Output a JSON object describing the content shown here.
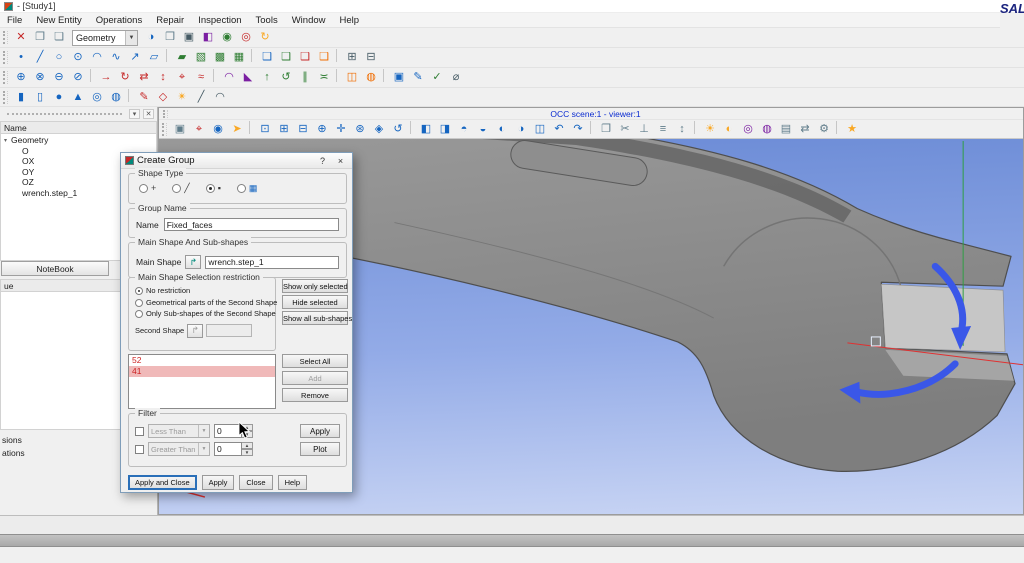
{
  "window": {
    "title": "- [Study1]",
    "logo": "SALOME"
  },
  "menubar": [
    "File",
    "New Entity",
    "Operations",
    "Repair",
    "Inspection",
    "Tools",
    "Window",
    "Help"
  ],
  "toolbar1": {
    "combo_value": "Geometry",
    "left_icons": [
      {
        "name": "delete-icon",
        "glyph": "✕",
        "color": "#c62828"
      },
      {
        "name": "copy-icon",
        "glyph": "❐",
        "color": "#5f7c8a"
      },
      {
        "name": "paste-icon",
        "glyph": "❏",
        "color": "#5f7c8a"
      }
    ],
    "right_icons": [
      {
        "name": "geometry-module-icon",
        "glyph": "◑",
        "color": "#1565c0"
      },
      {
        "name": "new-window-icon",
        "glyph": "❒",
        "color": "#5f7c8a"
      },
      {
        "name": "dump-view-icon",
        "glyph": "▣",
        "color": "#455a64"
      },
      {
        "name": "display-mode-icon",
        "glyph": "◧",
        "color": "#7b1fa2"
      },
      {
        "name": "show-all-icon",
        "glyph": "◉",
        "color": "#2e7d32"
      },
      {
        "name": "erase-all-icon",
        "glyph": "◎",
        "color": "#c62828"
      },
      {
        "name": "update-icon",
        "glyph": "↻",
        "color": "#f9a825"
      }
    ]
  },
  "toolbar2": {
    "icons": [
      {
        "name": "point-icon",
        "glyph": "•",
        "color": "#1565c0"
      },
      {
        "name": "line-icon",
        "glyph": "╱",
        "color": "#1565c0"
      },
      {
        "name": "circle-icon",
        "glyph": "○",
        "color": "#1565c0"
      },
      {
        "name": "ellipse-icon",
        "glyph": "⊙",
        "color": "#1565c0"
      },
      {
        "name": "arc-icon",
        "glyph": "◠",
        "color": "#1565c0"
      },
      {
        "name": "curve-icon",
        "glyph": "∿",
        "color": "#1565c0"
      },
      {
        "name": "vector-icon",
        "glyph": "↗",
        "color": "#1565c0"
      },
      {
        "name": "plane-icon",
        "glyph": "▱",
        "color": "#1565c0"
      },
      {
        "name": "separator",
        "sep": true,
        "interactable": "false"
      },
      {
        "name": "face-icon",
        "glyph": "▰",
        "color": "#2e7d32"
      },
      {
        "name": "shell-icon",
        "glyph": "▧",
        "color": "#2e7d32"
      },
      {
        "name": "solid-icon",
        "glyph": "▩",
        "color": "#2e7d32"
      },
      {
        "name": "compound-icon",
        "glyph": "▦",
        "color": "#2e7d32"
      },
      {
        "name": "separator",
        "sep": true,
        "interactable": "false"
      },
      {
        "name": "doc-blue-icon",
        "glyph": "❑",
        "color": "#1565c0"
      },
      {
        "name": "doc-green-icon",
        "glyph": "❑",
        "color": "#2e7d32"
      },
      {
        "name": "doc-red-icon",
        "glyph": "❑",
        "color": "#c62828"
      },
      {
        "name": "doc-yellow-icon",
        "glyph": "❑",
        "color": "#ef6c00"
      },
      {
        "name": "separator",
        "sep": true,
        "interactable": "false"
      },
      {
        "name": "grid-icon",
        "glyph": "⊞",
        "color": "#455a64"
      },
      {
        "name": "table-icon",
        "glyph": "⊟",
        "color": "#455a64"
      }
    ]
  },
  "toolbar3": {
    "icons": [
      {
        "name": "fuse-icon",
        "glyph": "⊕",
        "color": "#1565c0"
      },
      {
        "name": "common-icon",
        "glyph": "⊗",
        "color": "#1565c0"
      },
      {
        "name": "cut-icon",
        "glyph": "⊖",
        "color": "#1565c0"
      },
      {
        "name": "section-icon",
        "glyph": "⊘",
        "color": "#1565c0"
      },
      {
        "name": "separator",
        "sep": true,
        "interactable": "false"
      },
      {
        "name": "translate-icon",
        "glyph": "→",
        "color": "#c62828"
      },
      {
        "name": "rotate-icon",
        "glyph": "↻",
        "color": "#c62828"
      },
      {
        "name": "mirror-icon",
        "glyph": "⇄",
        "color": "#c62828"
      },
      {
        "name": "scale-icon",
        "glyph": "↕",
        "color": "#c62828"
      },
      {
        "name": "position-icon",
        "glyph": "⌖",
        "color": "#c62828"
      },
      {
        "name": "offset-icon",
        "glyph": "≈",
        "color": "#c62828"
      },
      {
        "name": "separator",
        "sep": true,
        "interactable": "false"
      },
      {
        "name": "fillet-icon",
        "glyph": "◠",
        "color": "#7b1fa2"
      },
      {
        "name": "chamfer-icon",
        "glyph": "◣",
        "color": "#7b1fa2"
      },
      {
        "name": "extrude-icon",
        "glyph": "↑",
        "color": "#2e7d32"
      },
      {
        "name": "revolve-icon",
        "glyph": "↺",
        "color": "#2e7d32"
      },
      {
        "name": "pipe-icon",
        "glyph": "∥",
        "color": "#2e7d32"
      },
      {
        "name": "loft-icon",
        "glyph": "≍",
        "color": "#2e7d32"
      },
      {
        "name": "separator",
        "sep": true,
        "interactable": "false"
      },
      {
        "name": "partition-icon",
        "glyph": "◫",
        "color": "#ef6c00"
      },
      {
        "name": "archimede-icon",
        "glyph": "◍",
        "color": "#ef6c00"
      },
      {
        "name": "separator",
        "sep": true,
        "interactable": "false"
      },
      {
        "name": "create-group-icon",
        "glyph": "▣",
        "color": "#1565c0"
      },
      {
        "name": "edit-group-icon",
        "glyph": "✎",
        "color": "#1565c0"
      },
      {
        "name": "check-shape-icon",
        "glyph": "✓",
        "color": "#2e7d32"
      },
      {
        "name": "measure-icon",
        "glyph": "⌀",
        "color": "#455a64"
      }
    ]
  },
  "toolbar4": {
    "icons": [
      {
        "name": "box-icon",
        "glyph": "▮",
        "color": "#1565c0"
      },
      {
        "name": "cylinder-icon",
        "glyph": "▯",
        "color": "#1565c0"
      },
      {
        "name": "sphere-icon",
        "glyph": "●",
        "color": "#1565c0"
      },
      {
        "name": "cone-icon",
        "glyph": "▲",
        "color": "#1565c0"
      },
      {
        "name": "torus-icon",
        "glyph": "◎",
        "color": "#1565c0"
      },
      {
        "name": "disk-icon",
        "glyph": "◍",
        "color": "#1565c0"
      },
      {
        "name": "separator",
        "sep": true,
        "interactable": "false"
      },
      {
        "name": "sketch-icon",
        "glyph": "✎",
        "color": "#c62828"
      },
      {
        "name": "sketch-3d-icon",
        "glyph": "◇",
        "color": "#c62828"
      },
      {
        "name": "explode-icon",
        "glyph": "✴",
        "color": "#f9a825"
      },
      {
        "name": "line-tool-icon",
        "glyph": "╱",
        "color": "#455a64"
      },
      {
        "name": "arc-tool-icon",
        "glyph": "◠",
        "color": "#455a64"
      }
    ]
  },
  "object_browser": {
    "column": "Name",
    "items": [
      {
        "label": "Geometry",
        "pad": "1px",
        "expander": "▾"
      },
      {
        "label": "O",
        "pad": "12px",
        "expander": ""
      },
      {
        "label": "OX",
        "pad": "12px",
        "expander": ""
      },
      {
        "label": "OY",
        "pad": "12px",
        "expander": ""
      },
      {
        "label": "OZ",
        "pad": "12px",
        "expander": ""
      },
      {
        "label": "wrench.step_1",
        "pad": "12px",
        "expander": ""
      }
    ]
  },
  "notebook_label": "NoteBook",
  "value_column": "ue",
  "fragments": [
    "sions",
    "ations"
  ],
  "viewer": {
    "caption": "OCC scene:1 - viewer:1",
    "toolbar_icons": [
      {
        "name": "dump-view-icon",
        "glyph": "▣",
        "color": "#5f7c8a"
      },
      {
        "name": "show-trihedron-icon",
        "glyph": "⌖",
        "color": "#c62828"
      },
      {
        "name": "preselection-icon",
        "glyph": "◉",
        "color": "#1565c0"
      },
      {
        "name": "selection-icon",
        "glyph": "➤",
        "color": "#f9a825"
      },
      {
        "name": "separator",
        "sep": true,
        "interactable": "false"
      },
      {
        "name": "fit-all-icon",
        "glyph": "⊡",
        "color": "#1565c0"
      },
      {
        "name": "fit-area-icon",
        "glyph": "⊞",
        "color": "#1565c0"
      },
      {
        "name": "fit-selection-icon",
        "glyph": "⊟",
        "color": "#1565c0"
      },
      {
        "name": "zoom-icon",
        "glyph": "⊕",
        "color": "#1565c0"
      },
      {
        "name": "pan-icon",
        "glyph": "✛",
        "color": "#1565c0"
      },
      {
        "name": "global-pan-icon",
        "glyph": "⊛",
        "color": "#1565c0"
      },
      {
        "name": "rotation-point-icon",
        "glyph": "◈",
        "color": "#1565c0"
      },
      {
        "name": "rotate-view-icon",
        "glyph": "↺",
        "color": "#1565c0"
      },
      {
        "name": "separator",
        "sep": true,
        "interactable": "false"
      },
      {
        "name": "front-view-icon",
        "glyph": "◧",
        "color": "#1565c0"
      },
      {
        "name": "back-view-icon",
        "glyph": "◨",
        "color": "#1565c0"
      },
      {
        "name": "top-view-icon",
        "glyph": "◓",
        "color": "#1565c0"
      },
      {
        "name": "bottom-view-icon",
        "glyph": "◒",
        "color": "#1565c0"
      },
      {
        "name": "left-view-icon",
        "glyph": "◐",
        "color": "#1565c0"
      },
      {
        "name": "right-view-icon",
        "glyph": "◑",
        "color": "#1565c0"
      },
      {
        "name": "iso-view-icon",
        "glyph": "◫",
        "color": "#1565c0"
      },
      {
        "name": "rotate-left-icon",
        "glyph": "↶",
        "color": "#1565c0"
      },
      {
        "name": "rotate-right-icon",
        "glyph": "↷",
        "color": "#1565c0"
      },
      {
        "name": "separator",
        "sep": true,
        "interactable": "false"
      },
      {
        "name": "clone-view-icon",
        "glyph": "❐",
        "color": "#5f7c8a"
      },
      {
        "name": "clipping-icon",
        "glyph": "✂",
        "color": "#5f7c8a"
      },
      {
        "name": "axes-icon",
        "glyph": "⊥",
        "color": "#5f7c8a"
      },
      {
        "name": "graduated-axes-icon",
        "glyph": "≡",
        "color": "#5f7c8a"
      },
      {
        "name": "scaling-icon",
        "glyph": "↕",
        "color": "#5f7c8a"
      },
      {
        "name": "separator",
        "sep": true,
        "interactable": "false"
      },
      {
        "name": "ambient-light-icon",
        "glyph": "☀",
        "color": "#f9a825"
      },
      {
        "name": "shading-icon",
        "glyph": "◐",
        "color": "#f9a825"
      },
      {
        "name": "ray-tracing-icon",
        "glyph": "◎",
        "color": "#7b1fa2"
      },
      {
        "name": "environment-icon",
        "glyph": "◍",
        "color": "#7b1fa2"
      },
      {
        "name": "background-icon",
        "glyph": "▤",
        "color": "#5f7c8a"
      },
      {
        "name": "sync-views-icon",
        "glyph": "⇄",
        "color": "#5f7c8a"
      },
      {
        "name": "settings-icon",
        "glyph": "⚙",
        "color": "#5f7c8a"
      },
      {
        "name": "separator",
        "sep": true,
        "interactable": "false"
      },
      {
        "name": "presets-icon",
        "glyph": "★",
        "color": "#f9a825"
      }
    ]
  },
  "dialog": {
    "title": "Create Group",
    "help_glyph": "?",
    "close_glyph": "×",
    "shape_type": {
      "label": "Shape Type",
      "options": [
        {
          "name": "shape-type-vertex",
          "glyph": "+",
          "color": "#444444",
          "selected": false
        },
        {
          "name": "shape-type-edge",
          "glyph": "╱",
          "color": "#444444",
          "selected": false
        },
        {
          "name": "shape-type-face",
          "glyph": "▪",
          "color": "#333333",
          "selected": true
        },
        {
          "name": "shape-type-solid",
          "glyph": "▦",
          "color": "#1565c0",
          "selected": false
        }
      ]
    },
    "group_name": {
      "label": "Group Name",
      "field_label": "Name",
      "value": "Fixed_faces"
    },
    "main_shape": {
      "label": "Main Shape And Sub-shapes",
      "field_label": "Main Shape",
      "pick_glyph": "↱",
      "value": "wrench.step_1"
    },
    "restriction": {
      "label": "Main Shape Selection restriction",
      "options": [
        {
          "label": "No restriction",
          "selected": true
        },
        {
          "label": "Geometrical parts of the Second Shape",
          "selected": false
        },
        {
          "label": "Only Sub-shapes of the Second Shape",
          "selected": false
        }
      ],
      "second_shape_label": "Second Shape",
      "second_pick_glyph": "↱",
      "second_value": ""
    },
    "side_buttons": [
      "Show only selected",
      "Hide selected",
      "Show all sub-shapes"
    ],
    "list_items": [
      {
        "id": "52",
        "selected": false
      },
      {
        "id": "41",
        "selected": true
      }
    ],
    "list_buttons": [
      {
        "label": "Select All",
        "disabled": false
      },
      {
        "label": "Add",
        "disabled": true
      },
      {
        "label": "Remove",
        "disabled": false
      }
    ],
    "filter": {
      "label": "Filter",
      "rows": [
        {
          "combo": "Less Than",
          "value": "0",
          "button": "Apply"
        },
        {
          "combo": "Greater Than",
          "value": "0",
          "button": "Plot"
        }
      ]
    },
    "bottom_buttons": [
      {
        "label": "Apply and Close",
        "default": true
      },
      {
        "label": "Apply",
        "default": false
      },
      {
        "label": "Close",
        "default": false
      },
      {
        "label": "Help",
        "default": false
      }
    ]
  },
  "scene_colors": {
    "x_axis": "#e03131",
    "y_axis": "#2f9e44",
    "z_axis": "#2b4bd7",
    "arrow": "#3a57e8"
  }
}
